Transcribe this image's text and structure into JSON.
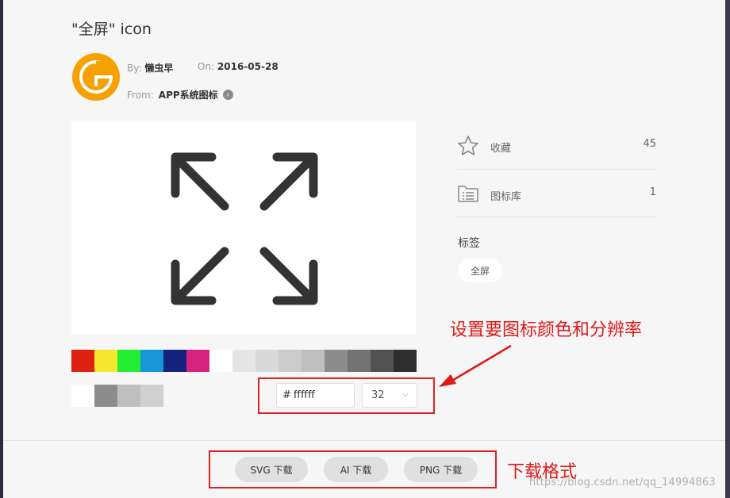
{
  "header": {
    "title": "\"全屏\" icon"
  },
  "meta": {
    "by_label": "By:",
    "by_value": "懒虫早",
    "on_label": "On:",
    "on_value": "2016-05-28",
    "from_label": "From:",
    "from_value": "APP系统图标"
  },
  "preview": {
    "icon": "fullscreen-arrows-icon",
    "color": "#333333"
  },
  "swatches": {
    "row1": [
      "#dd2211",
      "#f5e72e",
      "#22ee33",
      "#1796d8",
      "#14237e",
      "#d6247e",
      "#ffffff",
      "#e5e5e5",
      "#d9d9d9",
      "#cccccc",
      "#bfbfbf",
      "#8c8c8c",
      "#737373",
      "#525252",
      "#2e2e2e"
    ],
    "row2": [
      "#ffffff",
      "#8c8c8c",
      "#bfbfbf",
      "#d0d0d0"
    ]
  },
  "stats": {
    "favorite": {
      "icon": "star-icon",
      "label": "收藏",
      "count": "45"
    },
    "library": {
      "icon": "folder-list-icon",
      "label": "图标库",
      "count": "1"
    }
  },
  "tags": {
    "label": "标签",
    "items": [
      "全屏"
    ]
  },
  "settings": {
    "hash": "#",
    "color_value": "ffffff",
    "size_value": "32"
  },
  "annotations": {
    "settings_note": "设置要图标颜色和分辨率",
    "download_note": "下载格式"
  },
  "downloads": {
    "svg": "SVG 下载",
    "ai": "AI 下载",
    "png": "PNG 下载"
  },
  "watermark": "https://blog.csdn.net/qq_14994863",
  "colors": {
    "accent_red": "#e02020",
    "avatar_orange": "#f7a100"
  }
}
